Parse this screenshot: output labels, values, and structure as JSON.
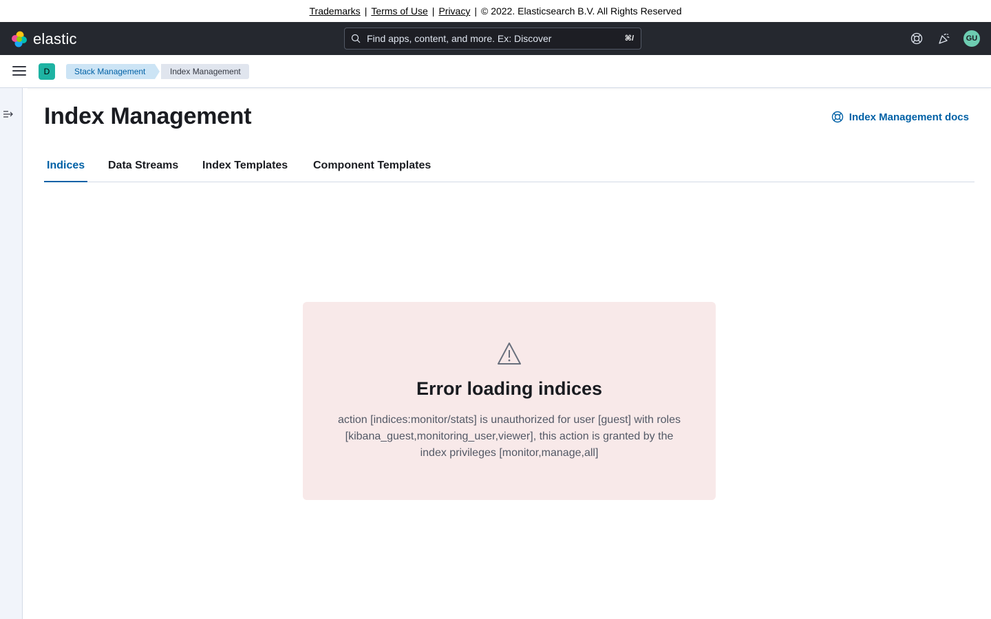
{
  "legal": {
    "trademarks": "Trademarks",
    "terms": "Terms of Use",
    "privacy": "Privacy",
    "sep": "|",
    "copyright": "© 2022. Elasticsearch B.V. All Rights Reserved"
  },
  "header": {
    "brand": "elastic",
    "search_placeholder": "Find apps, content, and more. Ex: Discover",
    "search_shortcut": "⌘/",
    "avatar_initials": "GU"
  },
  "subbar": {
    "space_initial": "D",
    "breadcrumbs": [
      "Stack Management",
      "Index Management"
    ]
  },
  "main": {
    "title": "Index Management",
    "docs_link": "Index Management docs",
    "tabs": [
      {
        "label": "Indices",
        "active": true
      },
      {
        "label": "Data Streams",
        "active": false
      },
      {
        "label": "Index Templates",
        "active": false
      },
      {
        "label": "Component Templates",
        "active": false
      }
    ],
    "error": {
      "title": "Error loading indices",
      "message": "action [indices:monitor/stats] is unauthorized for user [guest] with roles [kibana_guest,monitoring_user,viewer], this action is granted by the index privileges [monitor,manage,all]"
    }
  },
  "colors": {
    "accent": "#0061a6",
    "header_bg": "#25282f",
    "error_bg": "#f8e9e9"
  }
}
